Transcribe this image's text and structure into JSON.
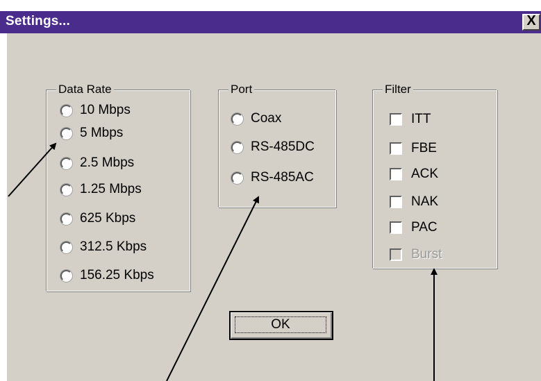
{
  "window": {
    "title": "Settings...",
    "close_label": "X"
  },
  "data_rate": {
    "label": "Data Rate",
    "options": [
      "10 Mbps",
      "5 Mbps",
      "2.5 Mbps",
      "1.25 Mbps",
      "625 Kbps",
      "312.5 Kbps",
      "156.25 Kbps"
    ]
  },
  "port": {
    "label": "Port",
    "options": [
      "Coax",
      "RS-485DC",
      "RS-485AC"
    ]
  },
  "filter": {
    "label": "Filter",
    "options": [
      "ITT",
      "FBE",
      "ACK",
      "NAK",
      "PAC",
      "Burst"
    ],
    "disabled": [
      "Burst"
    ]
  },
  "ok_label": "OK",
  "colors": {
    "titlebar": "#4a2c8c",
    "dialog_face": "#d4d0c8",
    "disabled_text": "#9a9a9a"
  }
}
